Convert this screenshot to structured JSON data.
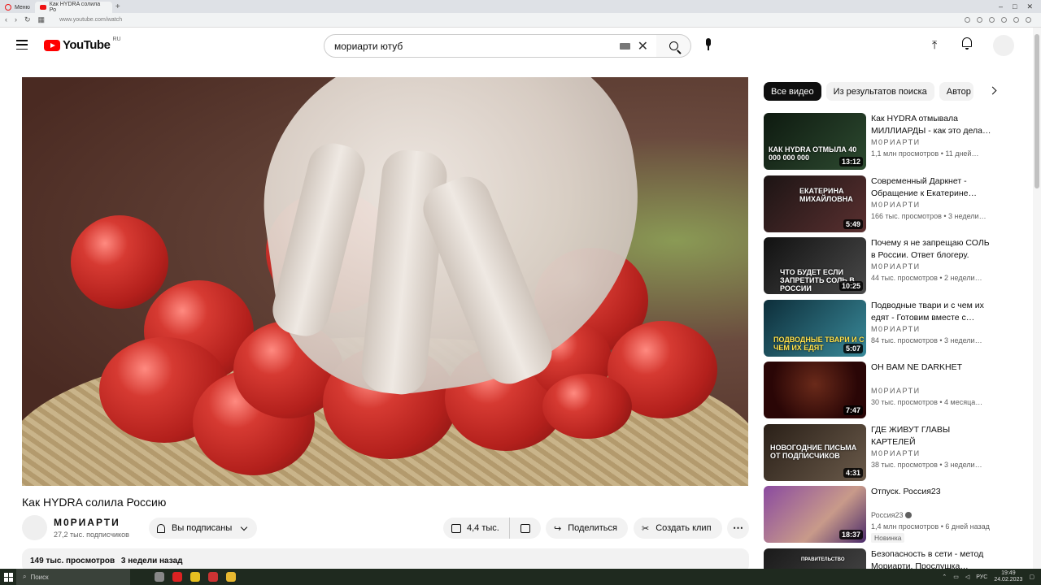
{
  "browser": {
    "tabs": [
      {
        "label": "Меню"
      },
      {
        "label": "Как HYDRA солила Ро"
      }
    ],
    "url": "www.youtube.com/watch"
  },
  "header": {
    "logo_text": "YouTube",
    "region": "RU",
    "search_value": "мориарти ютуб"
  },
  "video": {
    "title": "Как HYDRA солила Россию",
    "channel": "М0РИАРТИ",
    "subscribers": "27,2 тыс. подписчиков",
    "subscribed_label": "Вы подписаны",
    "likes": "4,4 тыс.",
    "share_label": "Поделиться",
    "clip_label": "Создать клип",
    "views": "149 тыс. просмотров",
    "age": "3 недели назад"
  },
  "chips": [
    "Все видео",
    "Из результатов поиска",
    "Автор"
  ],
  "recommendations": [
    {
      "title": "Как HYDRA отмывала МИЛЛИАРДЫ - как это дела…",
      "channel": "М0РИАРТИ",
      "meta": "1,1 млн просмотров • 11 дней…",
      "duration": "13:12",
      "thumb_text": "КАК HYDRA ОТМЫЛА 40 000 000 000",
      "thumb_bg": "#1a2a1c"
    },
    {
      "title": "Современный Даркнет - Обращение к Екатерине…",
      "channel": "М0РИАРТИ",
      "meta": "166 тыс. просмотров • 3 недели…",
      "duration": "5:49",
      "thumb_text": "ЕКАТЕРИНА МИХАЙЛОВНА",
      "thumb_bg": "#3a2a2a"
    },
    {
      "title": "Почему я не запрещаю СОЛЬ в России. Ответ блогеру.",
      "channel": "М0РИАРТИ",
      "meta": "44 тыс. просмотров • 2 недели…",
      "duration": "10:25",
      "thumb_text": "ЧТО БУДЕТ ЕСЛИ ЗАПРЕТИТЬ СОЛЬ В РОССИИ",
      "thumb_bg": "#2a2a2a"
    },
    {
      "title": "Подводные твари и с чем их едят - Готовим вместе с…",
      "channel": "М0РИАРТИ",
      "meta": "84 тыс. просмотров • 3 недели…",
      "duration": "5:07",
      "thumb_text": "ПОДВОДНЫЕ ТВАРИ И С ЧЕМ ИХ ЕДЯТ",
      "thumb_bg": "#1e4a5a"
    },
    {
      "title": "OH BAM NE DARKHET",
      "channel": "М0РИАРТИ",
      "meta": "30 тыс. просмотров • 4 месяца…",
      "duration": "7:47",
      "thumb_text": "",
      "thumb_bg": "#3a0c0c"
    },
    {
      "title": "ГДЕ ЖИВУТ ГЛАВЫ КАРТЕЛЕЙ",
      "channel": "М0РИАРТИ",
      "meta": "38 тыс. просмотров • 3 недели…",
      "duration": "4:31",
      "thumb_text": "НОВОГОДНИЕ ПИСЬМА ОТ ПОДПИСЧИКОВ",
      "thumb_bg": "#3a2e24"
    },
    {
      "title": "Отпуск. Россия23",
      "channel": "Россия23",
      "meta": "1,4 млн просмотров • 6 дней назад",
      "duration": "18:37",
      "thumb_text": "",
      "thumb_bg": "#6a3a8a",
      "badge": "Новинка"
    },
    {
      "title": "Безопасность в сети - метод Мориарти. Прослушка…",
      "channel": "",
      "meta": "",
      "duration": "",
      "thumb_text": "ПРАВИТЕЛЬСТВО",
      "thumb_bg": "#2a2a2a"
    }
  ],
  "taskbar": {
    "search_placeholder": "Поиск",
    "lang": "РУС",
    "time": "19:49",
    "date": "24.02.2023"
  }
}
